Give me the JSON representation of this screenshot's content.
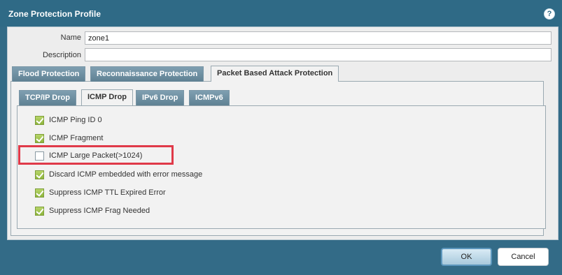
{
  "dialog": {
    "title": "Zone Protection Profile",
    "help_icon": "?"
  },
  "form": {
    "name_label": "Name",
    "name_value": "zone1",
    "description_label": "Description",
    "description_value": ""
  },
  "main_tabs": [
    {
      "label": "Flood Protection",
      "active": false
    },
    {
      "label": "Reconnaissance Protection",
      "active": false
    },
    {
      "label": "Packet Based Attack Protection",
      "active": true
    }
  ],
  "sub_tabs": [
    {
      "label": "TCP/IP Drop",
      "active": false
    },
    {
      "label": "ICMP Drop",
      "active": true
    },
    {
      "label": "IPv6 Drop",
      "active": false
    },
    {
      "label": "ICMPv6",
      "active": false
    }
  ],
  "options": [
    {
      "label": "ICMP Ping ID 0",
      "checked": true
    },
    {
      "label": "ICMP Fragment",
      "checked": true
    },
    {
      "label": "ICMP Large Packet(>1024)",
      "checked": false
    },
    {
      "label": "Discard ICMP embedded with error message",
      "checked": true
    },
    {
      "label": "Suppress ICMP TTL Expired Error",
      "checked": true
    },
    {
      "label": "Suppress ICMP Frag Needed",
      "checked": true
    }
  ],
  "footer": {
    "ok_label": "OK",
    "cancel_label": "Cancel"
  },
  "colors": {
    "title_bar": "#2f6a86",
    "highlight": "#e03a49",
    "checked": "#8db43c"
  }
}
